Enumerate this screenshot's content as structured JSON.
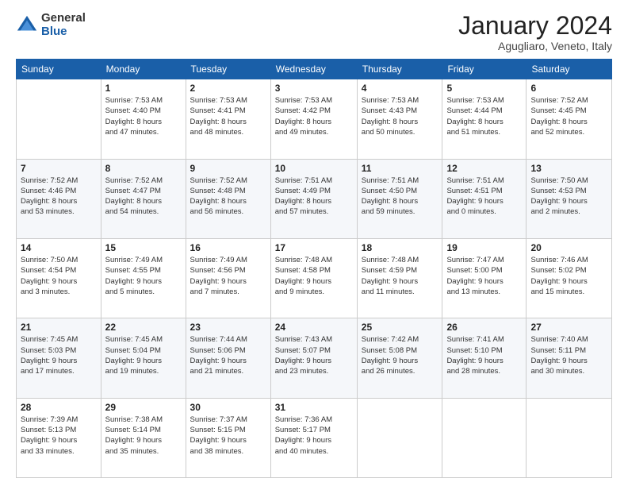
{
  "header": {
    "logo": {
      "general": "General",
      "blue": "Blue"
    },
    "title": "January 2024",
    "subtitle": "Agugliaro, Veneto, Italy"
  },
  "calendar": {
    "weekdays": [
      "Sunday",
      "Monday",
      "Tuesday",
      "Wednesday",
      "Thursday",
      "Friday",
      "Saturday"
    ],
    "weeks": [
      [
        {
          "day": "",
          "info": ""
        },
        {
          "day": "1",
          "info": "Sunrise: 7:53 AM\nSunset: 4:40 PM\nDaylight: 8 hours\nand 47 minutes."
        },
        {
          "day": "2",
          "info": "Sunrise: 7:53 AM\nSunset: 4:41 PM\nDaylight: 8 hours\nand 48 minutes."
        },
        {
          "day": "3",
          "info": "Sunrise: 7:53 AM\nSunset: 4:42 PM\nDaylight: 8 hours\nand 49 minutes."
        },
        {
          "day": "4",
          "info": "Sunrise: 7:53 AM\nSunset: 4:43 PM\nDaylight: 8 hours\nand 50 minutes."
        },
        {
          "day": "5",
          "info": "Sunrise: 7:53 AM\nSunset: 4:44 PM\nDaylight: 8 hours\nand 51 minutes."
        },
        {
          "day": "6",
          "info": "Sunrise: 7:52 AM\nSunset: 4:45 PM\nDaylight: 8 hours\nand 52 minutes."
        }
      ],
      [
        {
          "day": "7",
          "info": "Sunrise: 7:52 AM\nSunset: 4:46 PM\nDaylight: 8 hours\nand 53 minutes."
        },
        {
          "day": "8",
          "info": "Sunrise: 7:52 AM\nSunset: 4:47 PM\nDaylight: 8 hours\nand 54 minutes."
        },
        {
          "day": "9",
          "info": "Sunrise: 7:52 AM\nSunset: 4:48 PM\nDaylight: 8 hours\nand 56 minutes."
        },
        {
          "day": "10",
          "info": "Sunrise: 7:51 AM\nSunset: 4:49 PM\nDaylight: 8 hours\nand 57 minutes."
        },
        {
          "day": "11",
          "info": "Sunrise: 7:51 AM\nSunset: 4:50 PM\nDaylight: 8 hours\nand 59 minutes."
        },
        {
          "day": "12",
          "info": "Sunrise: 7:51 AM\nSunset: 4:51 PM\nDaylight: 9 hours\nand 0 minutes."
        },
        {
          "day": "13",
          "info": "Sunrise: 7:50 AM\nSunset: 4:53 PM\nDaylight: 9 hours\nand 2 minutes."
        }
      ],
      [
        {
          "day": "14",
          "info": "Sunrise: 7:50 AM\nSunset: 4:54 PM\nDaylight: 9 hours\nand 3 minutes."
        },
        {
          "day": "15",
          "info": "Sunrise: 7:49 AM\nSunset: 4:55 PM\nDaylight: 9 hours\nand 5 minutes."
        },
        {
          "day": "16",
          "info": "Sunrise: 7:49 AM\nSunset: 4:56 PM\nDaylight: 9 hours\nand 7 minutes."
        },
        {
          "day": "17",
          "info": "Sunrise: 7:48 AM\nSunset: 4:58 PM\nDaylight: 9 hours\nand 9 minutes."
        },
        {
          "day": "18",
          "info": "Sunrise: 7:48 AM\nSunset: 4:59 PM\nDaylight: 9 hours\nand 11 minutes."
        },
        {
          "day": "19",
          "info": "Sunrise: 7:47 AM\nSunset: 5:00 PM\nDaylight: 9 hours\nand 13 minutes."
        },
        {
          "day": "20",
          "info": "Sunrise: 7:46 AM\nSunset: 5:02 PM\nDaylight: 9 hours\nand 15 minutes."
        }
      ],
      [
        {
          "day": "21",
          "info": "Sunrise: 7:45 AM\nSunset: 5:03 PM\nDaylight: 9 hours\nand 17 minutes."
        },
        {
          "day": "22",
          "info": "Sunrise: 7:45 AM\nSunset: 5:04 PM\nDaylight: 9 hours\nand 19 minutes."
        },
        {
          "day": "23",
          "info": "Sunrise: 7:44 AM\nSunset: 5:06 PM\nDaylight: 9 hours\nand 21 minutes."
        },
        {
          "day": "24",
          "info": "Sunrise: 7:43 AM\nSunset: 5:07 PM\nDaylight: 9 hours\nand 23 minutes."
        },
        {
          "day": "25",
          "info": "Sunrise: 7:42 AM\nSunset: 5:08 PM\nDaylight: 9 hours\nand 26 minutes."
        },
        {
          "day": "26",
          "info": "Sunrise: 7:41 AM\nSunset: 5:10 PM\nDaylight: 9 hours\nand 28 minutes."
        },
        {
          "day": "27",
          "info": "Sunrise: 7:40 AM\nSunset: 5:11 PM\nDaylight: 9 hours\nand 30 minutes."
        }
      ],
      [
        {
          "day": "28",
          "info": "Sunrise: 7:39 AM\nSunset: 5:13 PM\nDaylight: 9 hours\nand 33 minutes."
        },
        {
          "day": "29",
          "info": "Sunrise: 7:38 AM\nSunset: 5:14 PM\nDaylight: 9 hours\nand 35 minutes."
        },
        {
          "day": "30",
          "info": "Sunrise: 7:37 AM\nSunset: 5:15 PM\nDaylight: 9 hours\nand 38 minutes."
        },
        {
          "day": "31",
          "info": "Sunrise: 7:36 AM\nSunset: 5:17 PM\nDaylight: 9 hours\nand 40 minutes."
        },
        {
          "day": "",
          "info": ""
        },
        {
          "day": "",
          "info": ""
        },
        {
          "day": "",
          "info": ""
        }
      ]
    ]
  }
}
